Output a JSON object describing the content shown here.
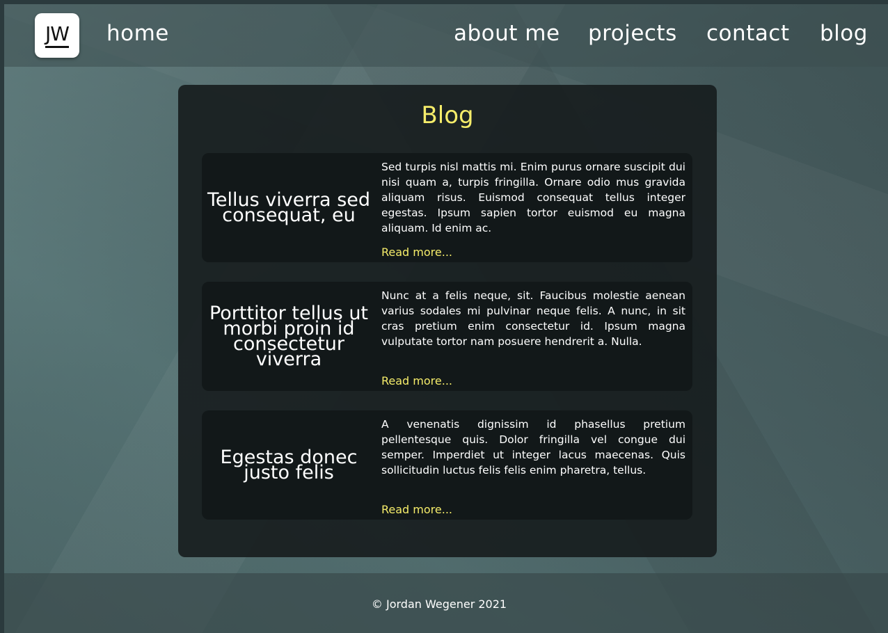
{
  "nav": {
    "logo_text": "JW",
    "home": "home",
    "about": "about me",
    "projects": "projects",
    "contact": "contact",
    "blog": "blog"
  },
  "main": {
    "title": "Blog",
    "posts": [
      {
        "title": "Tellus viverra sed consequat, eu",
        "excerpt": "Sed turpis nisl mattis mi. Enim purus ornare suscipit dui nisi quam a, turpis fringilla. Ornare odio mus gravida aliquam risus. Euismod consequat tellus integer egestas. Ipsum sapien tortor euismod eu magna aliquam. Id enim ac.",
        "link": "Read more..."
      },
      {
        "title": "Porttitor tellus ut morbi proin id consectetur viverra",
        "excerpt": "Nunc at a felis neque, sit. Faucibus molestie aenean varius sodales mi pulvinar neque felis. A nunc, in sit cras pretium enim consectetur id. Ipsum magna vulputate tortor nam posuere hendrerit a. Nulla.",
        "link": "Read more..."
      },
      {
        "title": "Egestas donec justo felis",
        "excerpt": "A venenatis dignissim id phasellus pretium pellentesque quis. Dolor fringilla vel congue dui semper. Imperdiet ut integer lacus maecenas. Quis sollicitudin luctus felis felis enim pharetra, tellus.",
        "link": "Read more..."
      }
    ]
  },
  "footer": {
    "copyright": "© Jordan Wegener 2021"
  },
  "colors": {
    "accent": "#f5ec6a",
    "card_bg": "#161c1d",
    "post_bg": "#121819",
    "text": "#ffffff"
  }
}
